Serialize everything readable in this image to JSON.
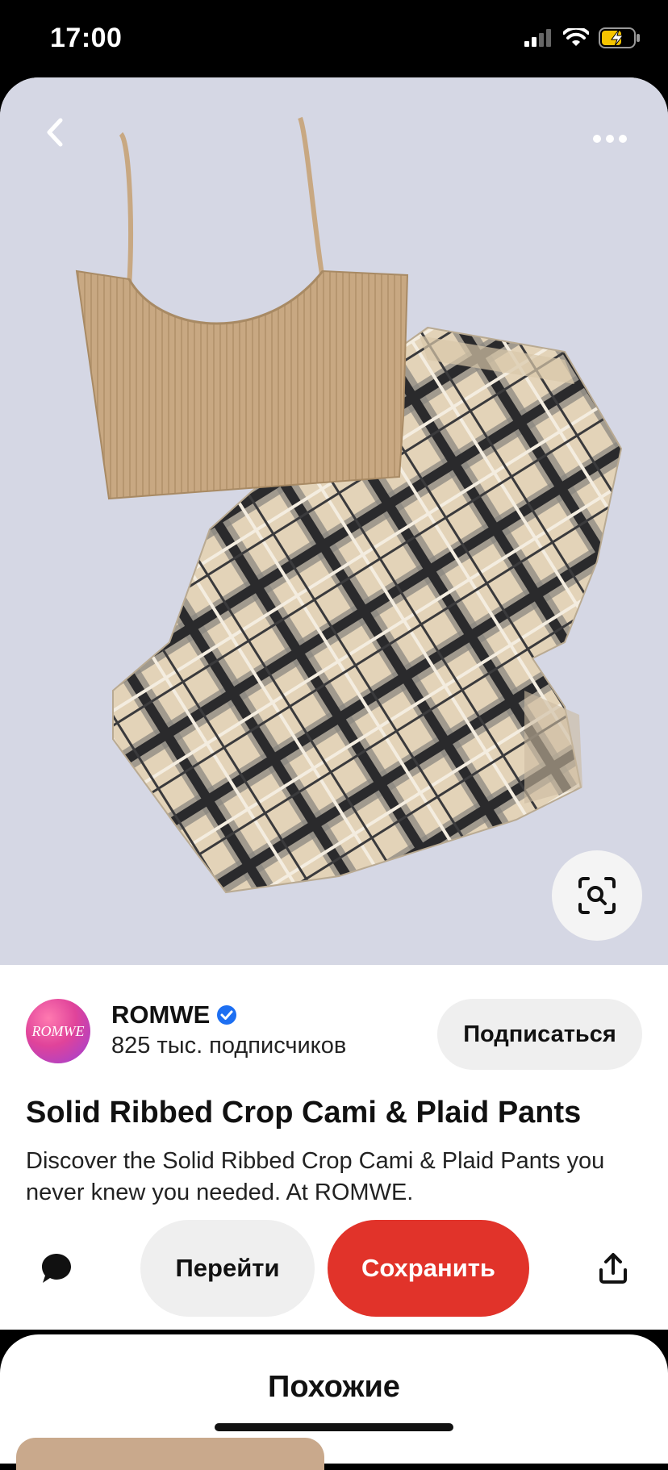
{
  "status_bar": {
    "time": "17:00",
    "icons": [
      "cellular-signal-icon",
      "wifi-icon",
      "battery-charging-icon"
    ]
  },
  "hero": {
    "icons": [
      "back-arrow-icon",
      "more-dots-icon",
      "visual-search-icon"
    ],
    "colors": {
      "background": "#d5d7e4",
      "top": "#c8a882",
      "plaid_light": "#e5d5bb",
      "plaid_dark": "#2a2a2c"
    }
  },
  "creator": {
    "avatar_text": "ROMWE",
    "name": "ROMWE",
    "verified_icon": "verified-badge-icon",
    "followers": "825 тыс. подписчиков",
    "subscribe_label": "Подписаться"
  },
  "pin": {
    "title": "Solid Ribbed Crop Cami & Plaid Pants",
    "description": "Discover the Solid Ribbed Crop Cami & Plaid Pants you never knew you needed. At ROMWE."
  },
  "actions": {
    "comment_icon": "comment-bubble-icon",
    "visit_label": "Перейти",
    "save_label": "Сохранить",
    "share_icon": "share-icon",
    "save_color": "#e1332a"
  },
  "similar": {
    "title": "Похожие"
  }
}
